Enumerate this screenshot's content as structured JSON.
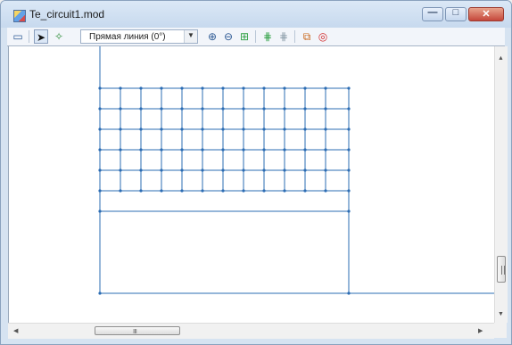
{
  "window": {
    "title": "Te_circuit1.mod"
  },
  "title_icon": "app-icon",
  "controls": [
    {
      "name": "minimize-button",
      "glyph": "—"
    },
    {
      "name": "maximize-button",
      "glyph": "□"
    },
    {
      "name": "close-button",
      "glyph": "✕"
    }
  ],
  "toolbar": {
    "line_mode": "Прямая линия (0°)",
    "icons": [
      "properties-icon",
      "select-arrow-icon",
      "magic-wand-icon",
      "zoom-in-icon",
      "zoom-out-icon",
      "zoom-fit-icon",
      "grid-nodes-icon",
      "grid-disabled-icon",
      "copy-icon",
      "target-icon"
    ]
  },
  "scrollbars": {
    "h_grip": "Ⅲ"
  },
  "canvas": {
    "line_color": "#2b6cb3"
  }
}
